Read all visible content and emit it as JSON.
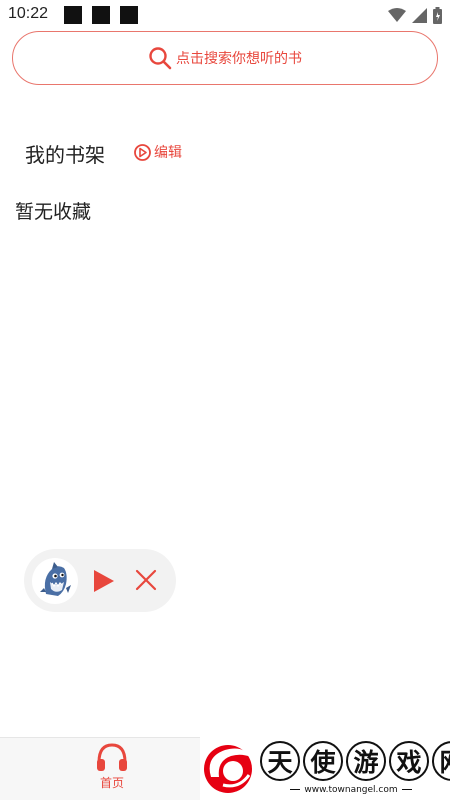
{
  "status_bar": {
    "time": "10:22"
  },
  "search": {
    "placeholder": "点击搜索你想听的书"
  },
  "shelf": {
    "title": "我的书架",
    "edit_label": "编辑",
    "empty_text": "暂无收藏"
  },
  "bottom_nav": {
    "home_label": "首页"
  },
  "watermark": {
    "chars": [
      "天",
      "使",
      "游",
      "戏",
      "网"
    ],
    "url": "www.townangel.com"
  },
  "colors": {
    "accent": "#e8473d",
    "border": "#e9766d",
    "player_bg": "#f2f2f2"
  },
  "icons": [
    "search-icon",
    "edit-icon",
    "play-icon",
    "close-icon",
    "headphones-icon",
    "wifi-icon",
    "signal-icon",
    "battery-icon"
  ]
}
